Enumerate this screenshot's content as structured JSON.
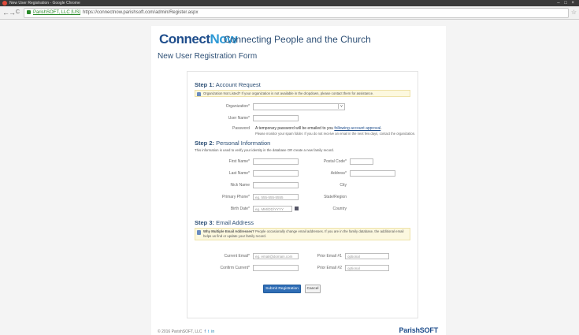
{
  "browser": {
    "window_title": "New User Registration - Google Chrome",
    "window_controls": "– □ ×",
    "nav": {
      "back": "←",
      "forward": "→",
      "reload": "C"
    },
    "address": {
      "ev_label": "ParishSOFT, LLC [US]",
      "url": "https://connectnow.parishsoft.com/admin/Register.aspx"
    },
    "star": "☆"
  },
  "header": {
    "logo_part1": "Connect",
    "logo_part2": "Now",
    "tagline": "Connecting People and the Church"
  },
  "form_title": "New User Registration Form",
  "step1": {
    "number": "Step 1:",
    "title": "Account Request",
    "note": "Organization Not Listed? If your organization is not available in the dropdown, please contact them for assistance.",
    "organization_label": "Organization*",
    "organization_value": "",
    "organization_caret": "v",
    "username_label": "User Name*",
    "password_label": "Password",
    "password_text_pre": "A temporary password will be emailed to you ",
    "password_link": "following account approval",
    "password_text_post": ".",
    "password_sub": "Please monitor your spam folder. If you do not receive an email in the next few days, contact the organization."
  },
  "step2": {
    "number": "Step 2:",
    "title": "Personal Information",
    "intro": "This information is used to verify your identity in the database OR create a new family record.",
    "first_name_label": "First Name*",
    "last_name_label": "Last Name*",
    "nick_name_label": "Nick Name",
    "primary_phone_label": "Primary Phone*",
    "primary_phone_placeholder": "eg. 555-555-5555",
    "birth_date_label": "Birth Date*",
    "birth_date_placeholder": "eg. MM/DD/YYYY",
    "postal_code_label": "Postal Code*",
    "address_label": "Address*",
    "city_label": "City",
    "state_label": "State/Region",
    "country_label": "Country"
  },
  "step3": {
    "number": "Step 3:",
    "title": "Email Address",
    "note_bold": "Why Multiple Email Addresses?",
    "note": " People occasionally change email addresses. If you are in the family database, the additional email helps us find or update your family record.",
    "current_email_label": "Current Email*",
    "current_email_placeholder": "eg. email@domain.com",
    "confirm_email_label": "Confirm Current*",
    "prior1_label": "Prior Email #1",
    "prior1_placeholder": "optional",
    "prior2_label": "Prior Email #2",
    "prior2_placeholder": "optional"
  },
  "actions": {
    "submit": "Submit Registration",
    "cancel": "Cancel"
  },
  "footer": {
    "copyright": "© 2016 ParishSOFT, LLC",
    "facebook": "f",
    "twitter": "t",
    "linkedin": "in",
    "brand": "ParishSOFT"
  }
}
